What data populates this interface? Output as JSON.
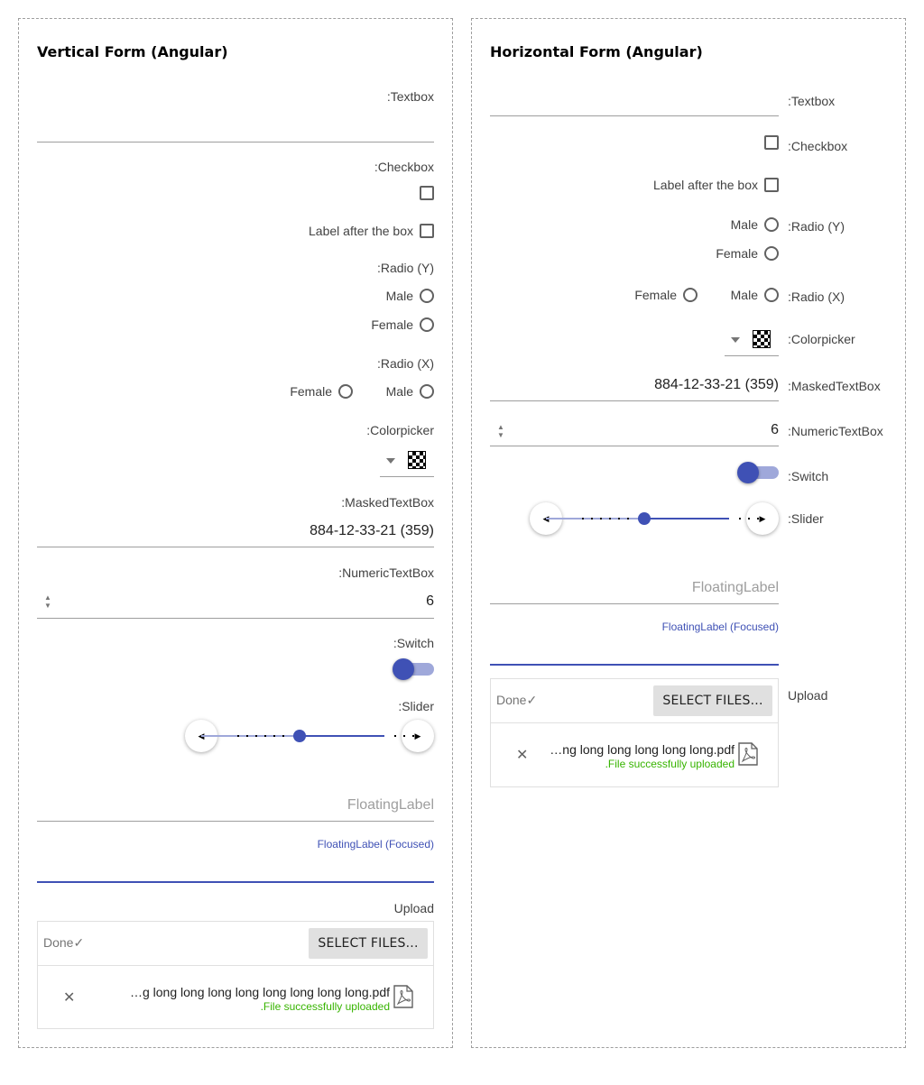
{
  "vertical": {
    "title": "Vertical Form (Angular)",
    "textbox_label": ":Textbox",
    "checkbox_label": ":Checkbox",
    "label_after_box": "Label after the box",
    "radio_y_label": ":Radio (Y)",
    "radio_y_options": [
      "Male",
      "Female"
    ],
    "radio_x_label": ":Radio (X)",
    "radio_x_options": [
      "Female",
      "Male"
    ],
    "colorpicker_label": ":Colorpicker",
    "masked_label": ":MaskedTextBox",
    "masked_value": "884-12-33-21 (359)",
    "numeric_label": ":NumericTextBox",
    "numeric_value": "6",
    "switch_label": ":Switch",
    "slider_label": ":Slider",
    "floating_label": "FloatingLabel",
    "floating_focused": "FloatingLabel (Focused)",
    "upload_label": "Upload",
    "upload_status": "Done",
    "select_files": "SELECT FILES...",
    "file_name": "…g long long long long long long long long.pdf",
    "file_status": ".File successfully uploaded"
  },
  "horizontal": {
    "title": "Horizontal Form (Angular)",
    "textbox_label": ":Textbox",
    "checkbox_label": ":Checkbox",
    "label_after_box": "Label after the box",
    "radio_y_label": ":Radio (Y)",
    "radio_y_options": [
      "Male",
      "Female"
    ],
    "radio_x_label": ":Radio (X)",
    "radio_x_options": [
      "Female",
      "Male"
    ],
    "colorpicker_label": ":Colorpicker",
    "masked_label": ":MaskedTextBox",
    "masked_value": "884-12-33-21 (359)",
    "numeric_label": ":NumericTextBox",
    "numeric_value": "6",
    "switch_label": ":Switch",
    "slider_label": ":Slider",
    "floating_label": "FloatingLabel",
    "floating_focused": "FloatingLabel (Focused)",
    "upload_label": "Upload",
    "upload_status": "Done",
    "select_files": "SELECT FILES...",
    "file_name": "…ng long long long long long.pdf",
    "file_status": ".File successfully uploaded"
  },
  "colors": {
    "accent": "#3f51b5",
    "success": "#37b400",
    "track": "#9fa8da"
  },
  "icons": {
    "check": "check-icon",
    "close": "close-icon",
    "pdf": "pdf-file-icon",
    "spin": "spin-arrows-icon"
  }
}
